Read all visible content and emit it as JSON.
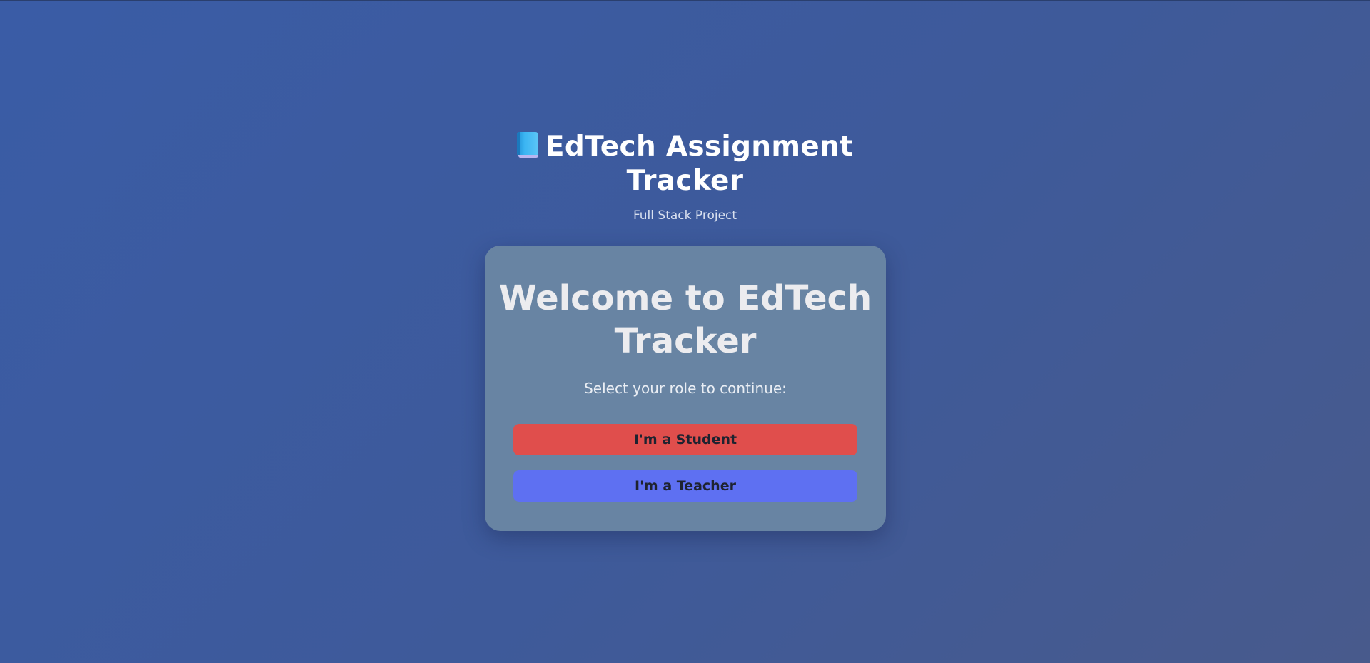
{
  "header": {
    "icon": "blue-book-icon",
    "title": "EdTech Assignment Tracker",
    "subtitle": "Full Stack Project"
  },
  "card": {
    "title": "Welcome to EdTech Tracker",
    "prompt": "Select your role to continue:",
    "buttons": [
      {
        "label": "I'm a Student",
        "color": "#e04e4c"
      },
      {
        "label": "I'm a Teacher",
        "color": "#5e70f2"
      }
    ]
  },
  "colors": {
    "background": "#3e5a9a",
    "card": "#6884a3"
  }
}
